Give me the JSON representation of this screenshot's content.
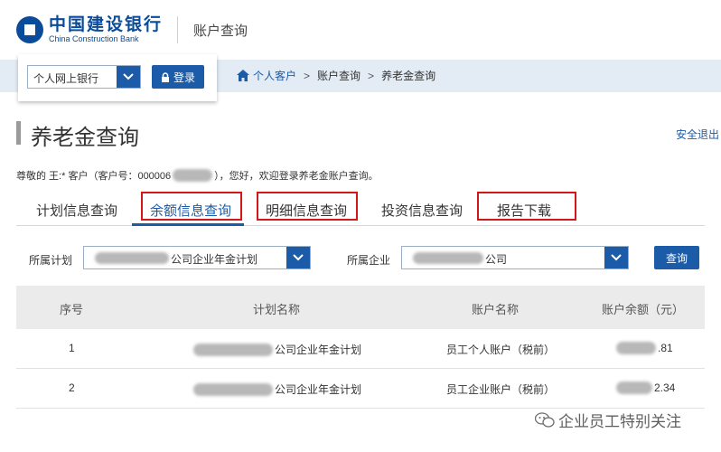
{
  "header": {
    "logo_cn": "中国建设银行",
    "logo_en": "China Construction Bank",
    "section_title": "账户查询"
  },
  "login": {
    "select_value": "个人网上银行",
    "login_label": "登录"
  },
  "breadcrumb": [
    "个人客户",
    "账户查询",
    "养老金查询"
  ],
  "page": {
    "title": "养老金查询",
    "logout": "安全退出",
    "greeting_prefix": "尊敬的 王:* 客户（客户号：000006",
    "greeting_suffix": "），您好，欢迎登录养老金账户查询。"
  },
  "tabs": [
    {
      "label": "计划信息查询",
      "active": false
    },
    {
      "label": "余额信息查询",
      "active": true
    },
    {
      "label": "明细信息查询",
      "active": false
    },
    {
      "label": "投资信息查询",
      "active": false
    },
    {
      "label": "报告下载",
      "active": false
    }
  ],
  "filters": {
    "plan_label": "所属计划",
    "plan_value": "公司企业年金计划",
    "company_label": "所属企业",
    "company_value": "公司",
    "query_label": "查询"
  },
  "table": {
    "headers": [
      "序号",
      "计划名称",
      "账户名称",
      "账户余额（元）"
    ],
    "rows": [
      {
        "no": "1",
        "plan": "公司企业年金计划",
        "account": "员工个人账户（税前）",
        "balance": ".81"
      },
      {
        "no": "2",
        "plan": "公司企业年金计划",
        "account": "员工企业账户（税前）",
        "balance": "2.34"
      }
    ]
  },
  "watermark": {
    "text": "企业员工特别关注"
  },
  "colors": {
    "brand_blue": "#1c5ba8",
    "highlight_red": "#d01818",
    "nav_bg": "#e3ebf4"
  }
}
